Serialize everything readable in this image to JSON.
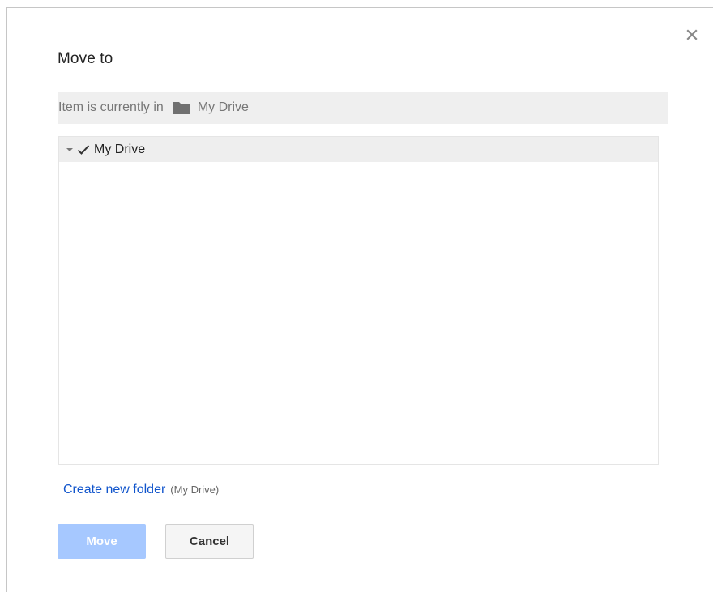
{
  "dialog": {
    "title": "Move to",
    "close_icon": "close-icon",
    "current_location": {
      "prefix": "Item is currently in",
      "icon": "folder-icon",
      "folder_name": "My Drive"
    },
    "tree": {
      "items": [
        {
          "label": "My Drive",
          "expanded": true,
          "selected": true,
          "toggle_icon": "triangle-down-icon",
          "check_icon": "checkmark-icon"
        }
      ]
    },
    "create_folder": {
      "link_label": "Create new folder",
      "hint": "(My Drive)"
    },
    "buttons": {
      "move_label": "Move",
      "cancel_label": "Cancel"
    }
  },
  "colors": {
    "link": "#1155cc",
    "primary_disabled": "#a6c8ff",
    "bar_background": "#efefef",
    "selected_row": "#eeeeee"
  }
}
